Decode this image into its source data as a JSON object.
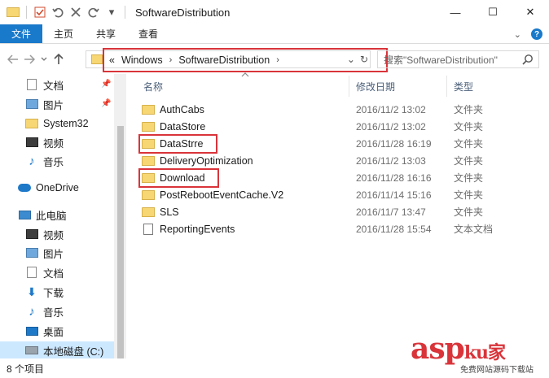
{
  "window": {
    "title": "SoftwareDistribution",
    "controls": {
      "minimize": "—",
      "maximize": "☐",
      "close": "✕"
    }
  },
  "quick_access": {
    "dropdown_glyph": "▾"
  },
  "ribbon": {
    "tabs": [
      "文件",
      "主页",
      "共享",
      "查看"
    ],
    "expand_glyph": "⌄",
    "help_glyph": "?"
  },
  "address": {
    "overflow_glyph": "«",
    "crumbs": [
      "Windows",
      "SoftwareDistribution"
    ],
    "crumb_sep": "›",
    "dropdown_glyph": "⌄",
    "refresh_glyph": "↻"
  },
  "search": {
    "placeholder": "搜索\"SoftwareDistribution\""
  },
  "sidebar": {
    "items": [
      {
        "label": "文档",
        "icon": "document-icon",
        "pinned": true
      },
      {
        "label": "图片",
        "icon": "picture-icon",
        "pinned": true
      },
      {
        "label": "System32",
        "icon": "folder-icon"
      },
      {
        "label": "视频",
        "icon": "video-icon"
      },
      {
        "label": "音乐",
        "icon": "music-icon"
      },
      {
        "label": "OneDrive",
        "icon": "cloud-icon"
      },
      {
        "label": "此电脑",
        "icon": "computer-icon"
      },
      {
        "label": "视频",
        "icon": "video-icon"
      },
      {
        "label": "图片",
        "icon": "picture-icon"
      },
      {
        "label": "文档",
        "icon": "document-icon"
      },
      {
        "label": "下载",
        "icon": "download-icon"
      },
      {
        "label": "音乐",
        "icon": "music-icon"
      },
      {
        "label": "桌面",
        "icon": "desktop-icon"
      },
      {
        "label": "本地磁盘 (C:)",
        "icon": "drive-icon",
        "selected": true
      }
    ]
  },
  "columns": {
    "name": "名称",
    "modified": "修改日期",
    "type": "类型"
  },
  "files": [
    {
      "name": "AuthCabs",
      "modified": "2016/11/2 13:02",
      "type": "文件夹",
      "icon": "folder-icon"
    },
    {
      "name": "DataStore",
      "modified": "2016/11/2 13:02",
      "type": "文件夹",
      "icon": "folder-icon"
    },
    {
      "name": "DataStrre",
      "modified": "2016/11/28 16:19",
      "type": "文件夹",
      "icon": "folder-icon"
    },
    {
      "name": "DeliveryOptimization",
      "modified": "2016/11/2 13:03",
      "type": "文件夹",
      "icon": "folder-icon"
    },
    {
      "name": "Download",
      "modified": "2016/11/28 16:16",
      "type": "文件夹",
      "icon": "folder-icon"
    },
    {
      "name": "PostRebootEventCache.V2",
      "modified": "2016/11/14 15:16",
      "type": "文件夹",
      "icon": "folder-icon"
    },
    {
      "name": "SLS",
      "modified": "2016/11/7 13:47",
      "type": "文件夹",
      "icon": "folder-icon"
    },
    {
      "name": "ReportingEvents",
      "modified": "2016/11/28 15:54",
      "type": "文本文档",
      "icon": "text-file-icon"
    }
  ],
  "status": {
    "item_count": "8 个项目"
  },
  "watermark": {
    "main": "asp",
    "ku": "ku",
    "cn": "家",
    "sub": "免费网站源码下载站"
  },
  "colors": {
    "accent": "#1979ca",
    "highlight": "#d9343a",
    "selected": "#cce8ff"
  }
}
